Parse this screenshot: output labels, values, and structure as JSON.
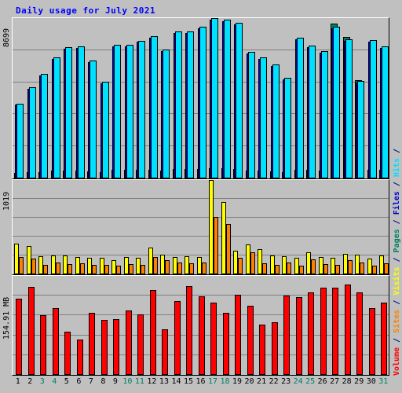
{
  "title": "Daily usage for July 2021",
  "axis_labels": {
    "top": "8699",
    "middle": "1019",
    "bottom": "154.91 MB"
  },
  "legend": {
    "separator": "/",
    "items": [
      {
        "label": "Hits",
        "color": "#00e0ff"
      },
      {
        "label": "Files",
        "color": "#0000cc"
      },
      {
        "label": "Pages",
        "color": "#008060"
      },
      {
        "label": "Visits",
        "color": "#ffff00"
      },
      {
        "label": "Sites",
        "color": "#ff8000"
      },
      {
        "label": "Volume",
        "color": "#ff0000"
      }
    ]
  },
  "x_axis": {
    "labels": [
      "1",
      "2",
      "3",
      "4",
      "5",
      "6",
      "7",
      "8",
      "9",
      "10",
      "11",
      "12",
      "13",
      "14",
      "15",
      "16",
      "17",
      "18",
      "19",
      "20",
      "21",
      "22",
      "23",
      "24",
      "25",
      "26",
      "27",
      "28",
      "29",
      "30",
      "31"
    ],
    "weekend_days": [
      3,
      4,
      10,
      11,
      17,
      18,
      24,
      25,
      31
    ],
    "weekend_color": "#008060",
    "weekday_color": "#000000"
  },
  "chart_data": [
    {
      "type": "bar",
      "title": "Daily usage for July 2021",
      "panel": "hits-files-pages",
      "xlabel": "",
      "ylabel": "",
      "ylim": [
        0,
        8699
      ],
      "grid": true,
      "gridlines": [
        1740,
        3480,
        5220,
        6960
      ],
      "categories": [
        "1",
        "2",
        "3",
        "4",
        "5",
        "6",
        "7",
        "8",
        "9",
        "10",
        "11",
        "12",
        "13",
        "14",
        "15",
        "16",
        "17",
        "18",
        "19",
        "20",
        "21",
        "22",
        "23",
        "24",
        "25",
        "26",
        "27",
        "28",
        "29",
        "30",
        "31"
      ],
      "series": [
        {
          "name": "Hits",
          "color": "#00e0ff",
          "values": [
            4060,
            4950,
            5680,
            6560,
            7110,
            7150,
            6390,
            5240,
            7250,
            7260,
            7480,
            7720,
            6980,
            7960,
            7980,
            8230,
            8699,
            8630,
            8450,
            6850,
            6560,
            6170,
            5450,
            7620,
            7190,
            6900,
            8230,
            7560,
            5270,
            7520,
            7170
          ]
        },
        {
          "name": "Files",
          "color": "#0000cc",
          "values": [
            3990,
            4870,
            5600,
            6480,
            7030,
            7060,
            6310,
            5160,
            7170,
            7180,
            7400,
            7640,
            6900,
            7880,
            7900,
            8150,
            8610,
            8540,
            8370,
            6780,
            6480,
            6100,
            5380,
            7540,
            7110,
            6820,
            8140,
            7480,
            5200,
            7440,
            7090
          ]
        },
        {
          "name": "Pages",
          "color": "#008060",
          "values": [
            300,
            340,
            360,
            410,
            420,
            430,
            400,
            330,
            450,
            450,
            460,
            490,
            430,
            500,
            500,
            520,
            540,
            540,
            530,
            430,
            410,
            390,
            340,
            480,
            450,
            430,
            8400,
            7680,
            5350,
            480,
            460
          ]
        }
      ]
    },
    {
      "type": "bar",
      "panel": "visits-sites",
      "xlabel": "",
      "ylabel": "",
      "ylim": [
        0,
        1019
      ],
      "grid": true,
      "gridlines": [
        204,
        408,
        612,
        815
      ],
      "categories": [
        "1",
        "2",
        "3",
        "4",
        "5",
        "6",
        "7",
        "8",
        "9",
        "10",
        "11",
        "12",
        "13",
        "14",
        "15",
        "16",
        "17",
        "18",
        "19",
        "20",
        "21",
        "22",
        "23",
        "24",
        "25",
        "26",
        "27",
        "28",
        "29",
        "30",
        "31"
      ],
      "series": [
        {
          "name": "Visits",
          "color": "#ffff00",
          "values": [
            330,
            305,
            195,
            205,
            205,
            185,
            180,
            175,
            155,
            185,
            180,
            290,
            210,
            185,
            195,
            190,
            1019,
            780,
            255,
            320,
            270,
            200,
            195,
            175,
            235,
            190,
            180,
            225,
            215,
            170,
            200
          ]
        },
        {
          "name": "Sites",
          "color": "#ff8000",
          "values": [
            190,
            170,
            100,
            130,
            110,
            115,
            105,
            100,
            90,
            110,
            105,
            185,
            150,
            125,
            120,
            130,
            620,
            545,
            180,
            240,
            115,
            105,
            125,
            90,
            165,
            110,
            105,
            150,
            130,
            90,
            120
          ]
        }
      ]
    },
    {
      "type": "bar",
      "panel": "volume",
      "xlabel": "",
      "ylabel": "",
      "ylim": [
        0,
        154.91
      ],
      "unit": "MB",
      "grid": true,
      "gridlines": [
        31,
        62,
        93,
        124
      ],
      "categories": [
        "1",
        "2",
        "3",
        "4",
        "5",
        "6",
        "7",
        "8",
        "9",
        "10",
        "11",
        "12",
        "13",
        "14",
        "15",
        "16",
        "17",
        "18",
        "19",
        "20",
        "21",
        "22",
        "23",
        "24",
        "25",
        "26",
        "27",
        "28",
        "29",
        "30",
        "31"
      ],
      "series": [
        {
          "name": "Volume",
          "color": "#ff0000",
          "values": [
            119.0,
            137.5,
            93.0,
            105.0,
            68.0,
            55.0,
            97.0,
            86.0,
            87.5,
            101.0,
            95.0,
            133.0,
            71.0,
            115.0,
            139.5,
            123.0,
            113.0,
            97.0,
            126.0,
            108.0,
            79.0,
            82.0,
            124.0,
            122.0,
            129.0,
            137.0,
            136.0,
            142.0,
            129.0,
            105.0,
            113.0,
            87.0
          ]
        }
      ]
    }
  ]
}
